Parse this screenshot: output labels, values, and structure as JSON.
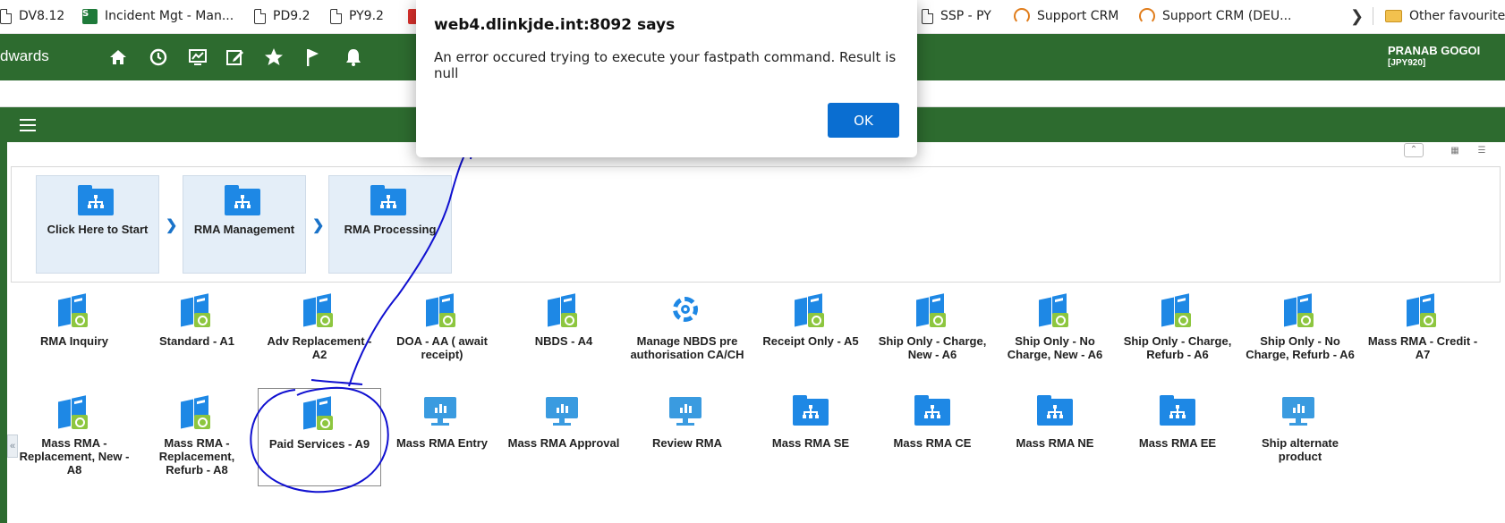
{
  "favourites": {
    "items": [
      {
        "label": "DV8.12",
        "icon": "doc-icon"
      },
      {
        "label": "Incident Mgt - Man...",
        "icon": "servicenow-icon"
      },
      {
        "label": "PD9.2",
        "icon": "doc-icon"
      },
      {
        "label": "PY9.2",
        "icon": "doc-icon"
      },
      {
        "label": "SSP - PY",
        "icon": "doc-icon"
      },
      {
        "label": "Support CRM",
        "icon": "headset-icon"
      },
      {
        "label": "Support CRM (DEU...",
        "icon": "headset-icon"
      }
    ],
    "other": "Other favourites"
  },
  "header": {
    "brand": "dwards",
    "user_name": "PRANAB GOGOI",
    "user_env": "[JPY920]",
    "nav_icons": [
      "home-icon",
      "recent-icon",
      "dashboard-icon",
      "edit-icon",
      "star-icon",
      "flag-icon",
      "bell-icon"
    ]
  },
  "breadcrumbs": [
    "Click Here to Start",
    "RMA Management",
    "RMA Processing"
  ],
  "tasks_row1": [
    {
      "label": "RMA Inquiry",
      "icon": "program-icon"
    },
    {
      "label": "Standard - A1",
      "icon": "program-icon"
    },
    {
      "label": "Adv Replacement - A2",
      "icon": "program-icon"
    },
    {
      "label": "DOA - AA ( await receipt)",
      "icon": "program-icon"
    },
    {
      "label": "NBDS - A4",
      "icon": "program-icon"
    },
    {
      "label": "Manage NBDS pre authorisation CA/CH",
      "icon": "gear-icon"
    },
    {
      "label": "Receipt Only - A5",
      "icon": "program-icon"
    },
    {
      "label": "Ship Only - Charge, New - A6",
      "icon": "program-icon"
    },
    {
      "label": "Ship Only - No Charge, New - A6",
      "icon": "program-icon"
    },
    {
      "label": "Ship Only - Charge, Refurb - A6",
      "icon": "program-icon"
    },
    {
      "label": "Ship Only - No Charge, Refurb - A6",
      "icon": "program-icon"
    },
    {
      "label": "Mass RMA - Credit - A7",
      "icon": "program-icon"
    }
  ],
  "tasks_row2": [
    {
      "label": "Mass RMA - Replacement, New - A8",
      "icon": "program-icon"
    },
    {
      "label": "Mass RMA - Replacement, Refurb - A8",
      "icon": "program-icon"
    },
    {
      "label": "Paid Services - A9",
      "icon": "program-icon"
    },
    {
      "label": "Mass RMA Entry",
      "icon": "monitor-icon"
    },
    {
      "label": "Mass RMA Approval",
      "icon": "monitor-icon"
    },
    {
      "label": "Review RMA",
      "icon": "monitor-icon"
    },
    {
      "label": "Mass RMA SE",
      "icon": "folder-icon"
    },
    {
      "label": "Mass RMA CE",
      "icon": "folder-icon"
    },
    {
      "label": "Mass RMA NE",
      "icon": "folder-icon"
    },
    {
      "label": "Mass RMA EE",
      "icon": "folder-icon"
    },
    {
      "label": "Ship alternate product",
      "icon": "monitor-icon"
    }
  ],
  "dialog": {
    "title": "web4.dlinkjde.int:8092 says",
    "message": "An error occured trying to execute your fastpath command. Result is null",
    "ok_label": "OK"
  },
  "colors": {
    "jde_green": "#2d6b2f",
    "icon_blue": "#1e88e5",
    "ok_blue": "#0a6ed1",
    "annotation_ink": "#1010d0"
  }
}
